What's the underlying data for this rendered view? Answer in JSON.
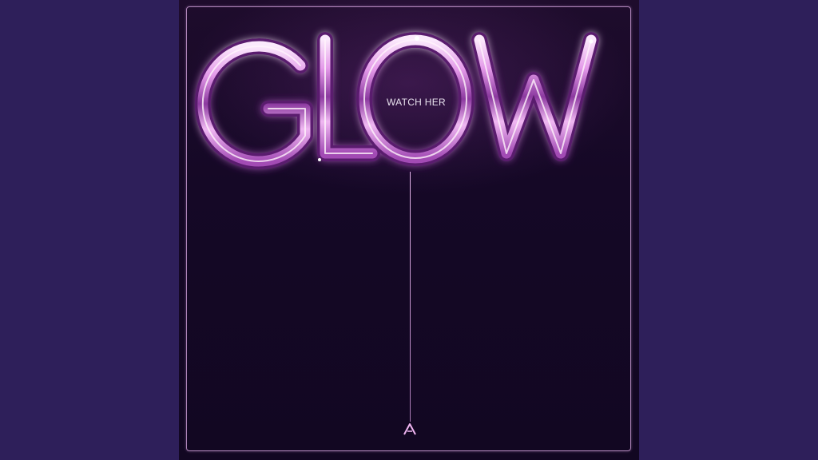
{
  "cover": {
    "title": "GLOW",
    "tagline": "WATCH HER",
    "logo_icon": "a-monogram-icon"
  },
  "colors": {
    "background": "#2e1f5a",
    "cover_bg": "#150826",
    "chrome_pink": "#e7a6ee",
    "frame_line": "#e1afeb",
    "tagline_text": "#e8e2ee"
  }
}
